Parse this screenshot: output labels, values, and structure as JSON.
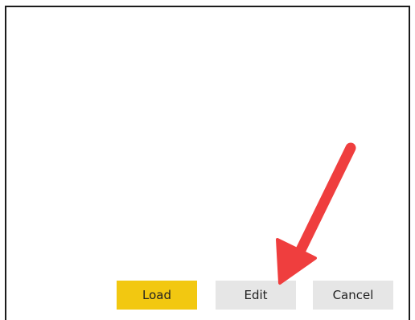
{
  "buttons": {
    "load_label": "Load",
    "edit_label": "Edit",
    "cancel_label": "Cancel"
  },
  "colors": {
    "load_background": "#f2c811",
    "secondary_background": "#e6e6e6",
    "frame_border": "#1c1c1c",
    "arrow": "#ef3e3e"
  },
  "annotation": {
    "icon": "red-arrow-icon",
    "points_to": "edit-button"
  }
}
